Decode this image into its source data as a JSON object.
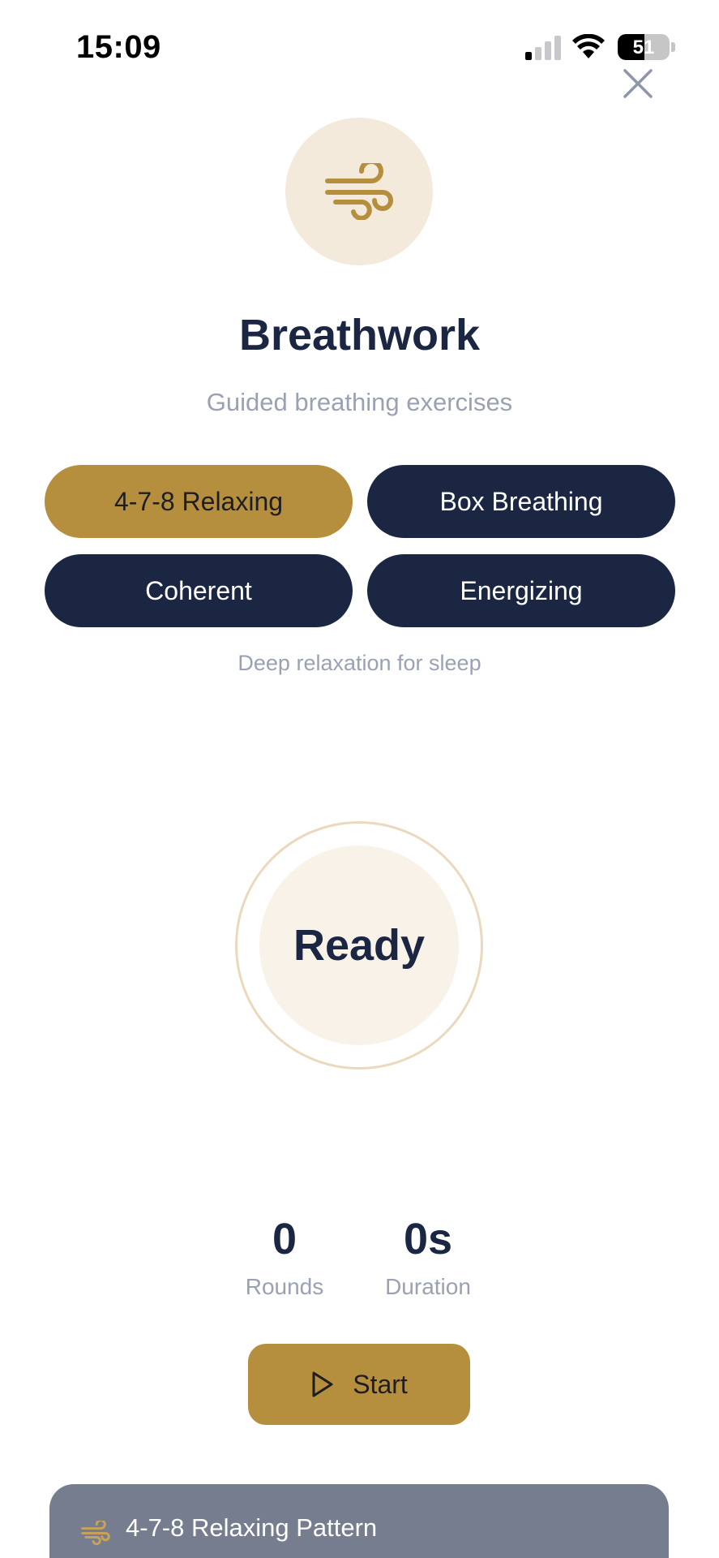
{
  "status_bar": {
    "time": "15:09",
    "battery": "51",
    "battery_level": 0.51
  },
  "header": {
    "close_icon": "close-icon",
    "hero_icon": "wind-icon",
    "title": "Breathwork",
    "subtitle": "Guided breathing exercises"
  },
  "patterns": {
    "items": [
      {
        "label": "4-7-8 Relaxing",
        "selected": true
      },
      {
        "label": "Box Breathing",
        "selected": false
      },
      {
        "label": "Coherent",
        "selected": false
      },
      {
        "label": "Energizing",
        "selected": false
      }
    ],
    "description": "Deep relaxation for sleep"
  },
  "breath_circle": {
    "state": "Ready"
  },
  "stats": {
    "rounds_value": "0",
    "rounds_label": "Rounds",
    "duration_value": "0s",
    "duration_label": "Duration"
  },
  "controls": {
    "start_label": "Start",
    "start_icon": "play-icon"
  },
  "info_card": {
    "icon": "wind-icon",
    "title": "4-7-8 Relaxing Pattern"
  },
  "colors": {
    "accent": "#b68f3e",
    "navy": "#1b2643",
    "muted": "#9aa1b2",
    "cream": "#f3eadb"
  }
}
